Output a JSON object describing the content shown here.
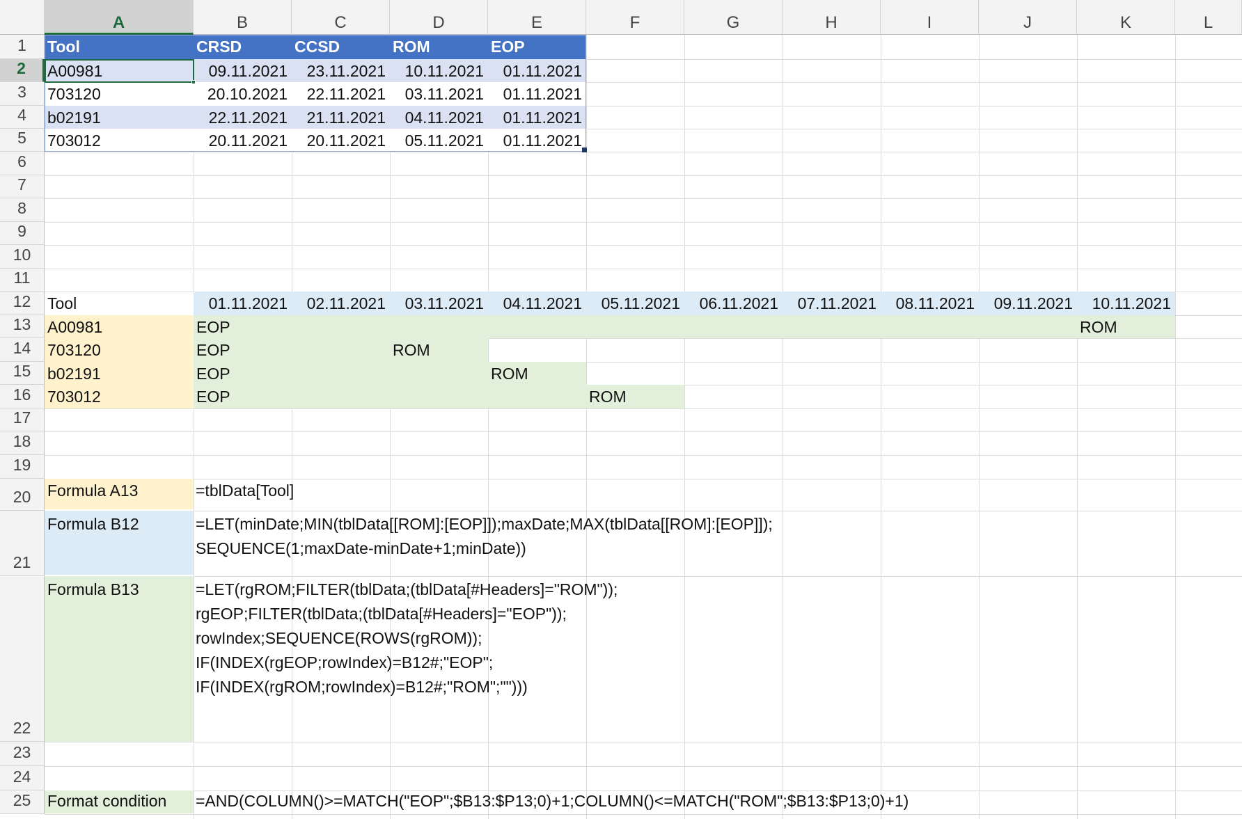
{
  "columns": [
    "A",
    "B",
    "C",
    "D",
    "E",
    "F",
    "G",
    "H",
    "I",
    "J",
    "K",
    "L"
  ],
  "rows": [
    "1",
    "2",
    "3",
    "4",
    "5",
    "6",
    "7",
    "8",
    "9",
    "10",
    "11",
    "12",
    "13",
    "14",
    "15",
    "16",
    "17",
    "18",
    "19",
    "20",
    "21",
    "22",
    "23",
    "24",
    "25"
  ],
  "table": {
    "headers": [
      "Tool",
      "CRSD",
      "CCSD",
      "ROM",
      "EOP"
    ],
    "rows": [
      [
        "A00981",
        "09.11.2021",
        "23.11.2021",
        "10.11.2021",
        "01.11.2021"
      ],
      [
        "703120",
        "20.10.2021",
        "22.11.2021",
        "03.11.2021",
        "01.11.2021"
      ],
      [
        "b02191",
        "22.11.2021",
        "21.11.2021",
        "04.11.2021",
        "01.11.2021"
      ],
      [
        "703012",
        "20.11.2021",
        "20.11.2021",
        "05.11.2021",
        "01.11.2021"
      ]
    ]
  },
  "timeline": {
    "tool_label": "Tool",
    "dates": [
      "01.11.2021",
      "02.11.2021",
      "03.11.2021",
      "04.11.2021",
      "05.11.2021",
      "06.11.2021",
      "07.11.2021",
      "08.11.2021",
      "09.11.2021",
      "10.11.2021"
    ],
    "tools": [
      "A00981",
      "703120",
      "b02191",
      "703012"
    ],
    "eop_label": "EOP",
    "rom_label": "ROM"
  },
  "notes": {
    "a13_label": "Formula A13",
    "a13_formula": "=tblData[Tool]",
    "b12_label": "Formula B12",
    "b12_lines": [
      "=LET(minDate;MIN(tblData[[ROM]:[EOP]]);maxDate;MAX(tblData[[ROM]:[EOP]]);",
      "SEQUENCE(1;maxDate-minDate+1;minDate))"
    ],
    "b13_label": "Formula B13",
    "b13_lines": [
      "=LET(rgROM;FILTER(tblData;(tblData[#Headers]=\"ROM\"));",
      "rgEOP;FILTER(tblData;(tblData[#Headers]=\"EOP\"));",
      "rowIndex;SEQUENCE(ROWS(rgROM));",
      "IF(INDEX(rgEOP;rowIndex)=B12#;\"EOP\";",
      "IF(INDEX(rgROM;rowIndex)=B12#;\"ROM\";\"\")))"
    ],
    "fc_label": "Format condition",
    "fc_formula": "=AND(COLUMN()>=MATCH(\"EOP\";$B13:$P13;0)+1;COLUMN()<=MATCH(\"ROM\";$B13:$P13;0)+1)"
  },
  "colors": {
    "table_header": "#4472c4",
    "table_band": "#d9e1f2",
    "tool_fill": "#fff2cc",
    "date_fill": "#ddebf7",
    "range_fill": "#e2efda",
    "active_border": "#1e6c3e"
  }
}
